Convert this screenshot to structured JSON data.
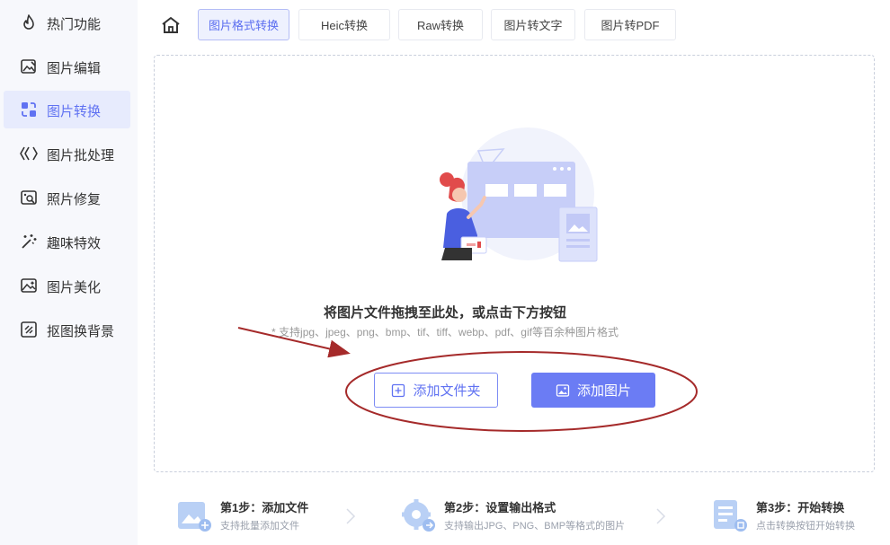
{
  "sidebar": {
    "items": [
      {
        "label": "热门功能",
        "icon": "flame-icon",
        "active": false
      },
      {
        "label": "图片编辑",
        "icon": "image-edit-icon",
        "active": false
      },
      {
        "label": "图片转换",
        "icon": "image-convert-icon",
        "active": true
      },
      {
        "label": "图片批处理",
        "icon": "batch-process-icon",
        "active": false
      },
      {
        "label": "照片修复",
        "icon": "photo-repair-icon",
        "active": false
      },
      {
        "label": "趣味特效",
        "icon": "magic-wand-icon",
        "active": false
      },
      {
        "label": "图片美化",
        "icon": "image-beautify-icon",
        "active": false
      },
      {
        "label": "抠图换背景",
        "icon": "cutout-icon",
        "active": false
      }
    ]
  },
  "tabs": [
    {
      "label": "图片格式转换",
      "active": true
    },
    {
      "label": "Heic转换",
      "active": false
    },
    {
      "label": "Raw转换",
      "active": false
    },
    {
      "label": "图片转文字",
      "active": false
    },
    {
      "label": "图片转PDF",
      "active": false
    }
  ],
  "dropzone": {
    "title": "将图片文件拖拽至此处，或点击下方按钮",
    "hint": "* 支持jpg、jpeg、png、bmp、tif、tiff、webp、pdf、gif等百余种图片格式",
    "add_folder_label": "添加文件夹",
    "add_image_label": "添加图片"
  },
  "steps": [
    {
      "title": "第1步：添加文件",
      "desc": "支持批量添加文件"
    },
    {
      "title": "第2步：设置输出格式",
      "desc": "支持输出JPG、PNG、BMP等格式的图片"
    },
    {
      "title": "第3步：开始转换",
      "desc": "点击转换按钮开始转换"
    }
  ],
  "colors": {
    "accent": "#6b7cf4",
    "annotation": "#a52a2a",
    "sidebar_bg": "#f7f8fc",
    "active_bg": "#e7ebfd"
  }
}
